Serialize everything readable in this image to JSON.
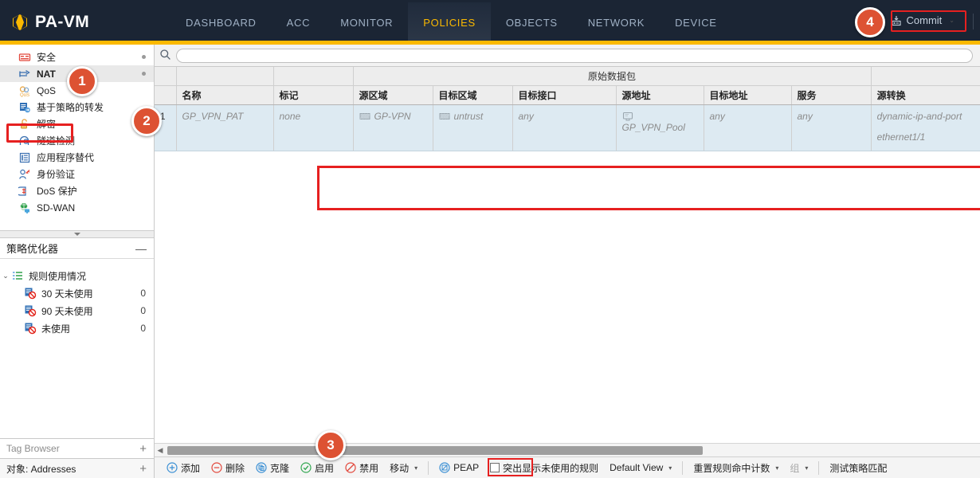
{
  "app": {
    "brand": "PA-VM",
    "logo_icon": "palo-alto-hex-logo"
  },
  "topnav": {
    "items": [
      {
        "label": "DASHBOARD",
        "active": false
      },
      {
        "label": "ACC",
        "active": false
      },
      {
        "label": "MONITOR",
        "active": false
      },
      {
        "label": "POLICIES",
        "active": true
      },
      {
        "label": "OBJECTS",
        "active": false
      },
      {
        "label": "NETWORK",
        "active": false
      },
      {
        "label": "DEVICE",
        "active": false
      }
    ],
    "commit": {
      "label": "Commit",
      "icon": "commit-upload-icon",
      "caret": "⌄"
    }
  },
  "sidebar": {
    "items": [
      {
        "label": "安全",
        "icon": "security-shield-icon",
        "selected": false,
        "dot": true
      },
      {
        "label": "NAT",
        "icon": "nat-arrow-icon",
        "selected": true,
        "dot": true
      },
      {
        "label": "QoS",
        "icon": "qos-icon",
        "selected": false,
        "dot": false
      },
      {
        "label": "基于策略的转发",
        "icon": "policy-based-forwarding-icon",
        "selected": false,
        "dot": false
      },
      {
        "label": "解密",
        "icon": "decryption-lock-icon",
        "selected": false,
        "dot": false
      },
      {
        "label": "隧道检测",
        "icon": "tunnel-inspection-icon",
        "selected": false,
        "dot": false
      },
      {
        "label": "应用程序替代",
        "icon": "application-override-icon",
        "selected": false,
        "dot": false
      },
      {
        "label": "身份验证",
        "icon": "authentication-icon",
        "selected": false,
        "dot": false
      },
      {
        "label": "DoS 保护",
        "icon": "dos-protection-icon",
        "selected": false,
        "dot": false
      },
      {
        "label": "SD-WAN",
        "icon": "sd-wan-icon",
        "selected": false,
        "dot": false
      }
    ],
    "optimizer": {
      "title": "策略优化器",
      "collapse": "—",
      "parent": {
        "label": "规则使用情况",
        "icon": "rule-usage-icon",
        "chevron": "⌄"
      },
      "children": [
        {
          "label": "30 天未使用",
          "count": "0",
          "icon": "unused-rule-icon"
        },
        {
          "label": "90 天未使用",
          "count": "0",
          "icon": "unused-rule-icon"
        },
        {
          "label": "未使用",
          "count": "0",
          "icon": "unused-rule-icon"
        }
      ]
    },
    "footer": [
      {
        "label": "Tag Browser",
        "plus": "+",
        "muted": true
      },
      {
        "label": "对象: Addresses",
        "plus": "+",
        "muted": false
      }
    ]
  },
  "main": {
    "search": {
      "placeholder": "",
      "value": "",
      "icon": "search-icon"
    },
    "table": {
      "group_headers": [
        {
          "label": "",
          "span": 1
        },
        {
          "label": "",
          "span": 1
        },
        {
          "label": "",
          "span": 1
        },
        {
          "label": "原始数据包",
          "span": 6
        },
        {
          "label": "",
          "span": 1
        }
      ],
      "columns": [
        "",
        "名称",
        "标记",
        "源区域",
        "目标区域",
        "目标接口",
        "源地址",
        "目标地址",
        "服务",
        "源转换"
      ],
      "rows": [
        {
          "num": "1",
          "name": "GP_VPN_PAT",
          "tag": "none",
          "src_zone": {
            "text": "GP-VPN",
            "icon": "zone-icon"
          },
          "dst_zone": {
            "text": "untrust",
            "icon": "zone-icon"
          },
          "dst_interface": "any",
          "src_address": {
            "text": "GP_VPN_Pool",
            "icon": "address-object-icon"
          },
          "dst_address": "any",
          "service": "any",
          "src_translation_line1": "dynamic-ip-and-port",
          "src_translation_line2": "ethernet1/1"
        }
      ]
    },
    "scrollbar": {
      "left_arrow": "◀",
      "right_arrow": "▶"
    }
  },
  "toolbar": {
    "buttons": [
      {
        "label": "添加",
        "icon": "add-plus-icon",
        "disabled": false
      },
      {
        "label": "删除",
        "icon": "delete-minus-icon",
        "disabled": false
      },
      {
        "label": "克隆",
        "icon": "clone-icon",
        "disabled": false
      },
      {
        "label": "启用",
        "icon": "enable-check-icon",
        "disabled": false
      },
      {
        "label": "禁用",
        "icon": "disable-slash-icon",
        "disabled": false
      },
      {
        "label": "移动",
        "icon": "",
        "disabled": false,
        "caret": "▾"
      }
    ],
    "peap": {
      "label": "PEAP",
      "icon": "peap-icon"
    },
    "highlight_unused": {
      "label": "突出显示未使用的规则",
      "checked": false
    },
    "view_select": {
      "label": "Default View",
      "caret": "▾"
    },
    "reset_hit_count": {
      "label": "重置规则命中计数",
      "caret": "▾"
    },
    "group": {
      "label": "组",
      "caret": "▾",
      "disabled": true
    },
    "test_policy_match": {
      "label": "测试策略匹配"
    }
  },
  "annotations": {
    "badges": [
      {
        "id": "1",
        "label": "1"
      },
      {
        "id": "2",
        "label": "2"
      },
      {
        "id": "3",
        "label": "3"
      },
      {
        "id": "4",
        "label": "4"
      }
    ],
    "highlight_color": "#e62020"
  },
  "colors": {
    "nav_bg": "#1b2534",
    "accent_yellow": "#fbb900",
    "row_selected_bg": "#ddeaf2",
    "badge_bg": "#dd5233"
  }
}
